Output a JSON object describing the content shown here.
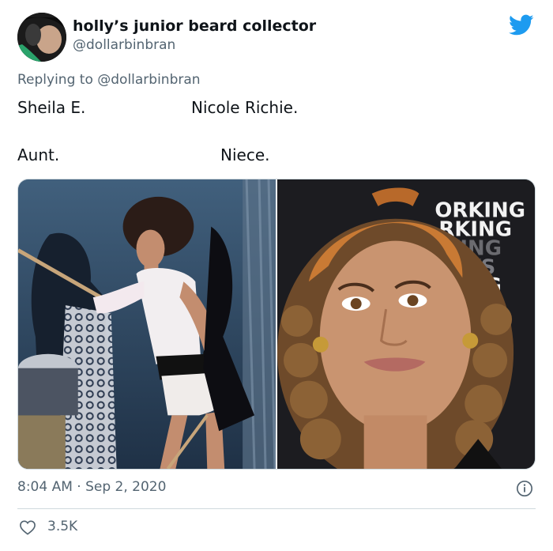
{
  "tweet": {
    "display_name": "holly’s junior beard collector",
    "handle": "@dollarbinbran",
    "replying_prefix": "Replying to",
    "replying_to": "@dollarbinbran",
    "lines": {
      "left_top": "Sheila E.",
      "right_top": "Nicole Richie.",
      "left_bottom": "Aunt.",
      "right_bottom": "Niece."
    },
    "timestamp": "8:04 AM · Sep 2, 2020",
    "likes": "3.5K",
    "background_sign_text": [
      "ORKING",
      "RKING",
      "KING",
      "AYS",
      "ING"
    ]
  },
  "colors": {
    "twitter_blue": "#1d9bf0",
    "secondary_text": "#536471",
    "border": "#cfd9de"
  },
  "icons": {
    "brand": "twitter-bird-icon",
    "info": "info-icon",
    "like": "heart-icon"
  }
}
